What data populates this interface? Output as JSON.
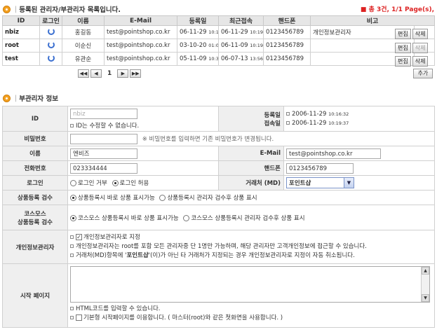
{
  "list_section": {
    "title": "등록된 관리자/부관리자 목록입니다."
  },
  "summary": "총 3건, 1/1 Page(s),",
  "table": {
    "headers": [
      "ID",
      "로그인",
      "이름",
      "E-Mail",
      "등록일",
      "최근접속",
      "핸드폰",
      "비고"
    ],
    "rows": [
      {
        "id": "nbiz",
        "name": "홍길동",
        "email": "test@pointshop.co.kr",
        "reg_date": "06-11-29",
        "reg_time": "10:16",
        "last_date": "06-11-29",
        "last_time": "10:19",
        "phone": "0123456789",
        "note": "개인정보관리자",
        "edit": "편집",
        "delete": "삭제"
      },
      {
        "id": "root",
        "name": "이순신",
        "email": "test@pointshop.co.kr",
        "reg_date": "03-10-20",
        "reg_time": "01:01",
        "last_date": "06-11-09",
        "last_time": "10:19",
        "phone": "0123456789",
        "note": "",
        "edit": "편집",
        "delete": "삭제"
      },
      {
        "id": "test",
        "name": "유관순",
        "email": "test@pointshop.co.kr",
        "reg_date": "05-11-09",
        "reg_time": "10:31",
        "last_date": "06-07-13",
        "last_time": "13:56",
        "phone": "0123456789",
        "note": "",
        "edit": "편집",
        "delete": "삭제"
      }
    ]
  },
  "pager": {
    "first": "◀◀",
    "prev": "◀",
    "page": "1",
    "next": "▶",
    "last": "▶▶",
    "add": "추가"
  },
  "form_section": {
    "title": "부관리자 정보"
  },
  "form": {
    "id_label": "ID",
    "id_value": "nbiz",
    "id_hint": "ID는 수정할 수 없습니다.",
    "reg_label": "등록일",
    "reg_date": "2006-11-29",
    "reg_time": "10:16:32",
    "login_label": "접속일",
    "login_date": "2006-11-29",
    "login_time": "10:19:37",
    "password_label": "비밀번호",
    "password_hint": "※ 비밀번호를 입력하면 기존 비밀번호가 변경됩니다.",
    "name_label": "이름",
    "name_value": "엔비즈",
    "email_label": "E-Mail",
    "email_value": "test@pointshop.co.kr",
    "phone_label": "전화번호",
    "phone_value": "023334444",
    "mobile_label": "핸드폰",
    "mobile_value": "0123456789",
    "login_row_label": "로그인",
    "login_deny": "로그인 거부",
    "login_allow": "로그인 허용",
    "vendor_label": "거래처 (MD)",
    "vendor_value": "포인트샵",
    "review_label": "상품등록 검수",
    "review_opt1": "상품등록시 바로 상품 표시가능",
    "review_opt2": "상품등록시 관리자 검수후 상품 표시",
    "cosmos_label1": "코스모스",
    "cosmos_label2": "상품등록 검수",
    "cosmos_opt1": "코스모스 상품등록시 바로 상품 표시가능",
    "cosmos_opt2": "코스모스 상품등록시 관리자 검수후 상품 표시",
    "privacy_label": "개인정보관리자",
    "privacy_check": "개인정보관리자로 지정",
    "privacy_note1": "개인정보관리자는 root를 포함 모든 관리자중 단 1명만 가능하며, 해당 관리자만 고객개인정보에 접근할 수 있습니다.",
    "privacy_note2_a": "거래처(MD)항목에 '",
    "privacy_note2_b": "포인트샵",
    "privacy_note2_c": "'(이)가 아닌 타 거래처가 지정되는 경우 개인정보관리자로 지정이 자동 취소됩니다.",
    "start_label": "시작 페이지",
    "html_note": "HTML코드를 입력할 수 있습니다.",
    "default_page": "기본형 시작페이지를 이용합니다. ( 마스터(root)와 같은 첫화면을 사용합니다. )"
  }
}
